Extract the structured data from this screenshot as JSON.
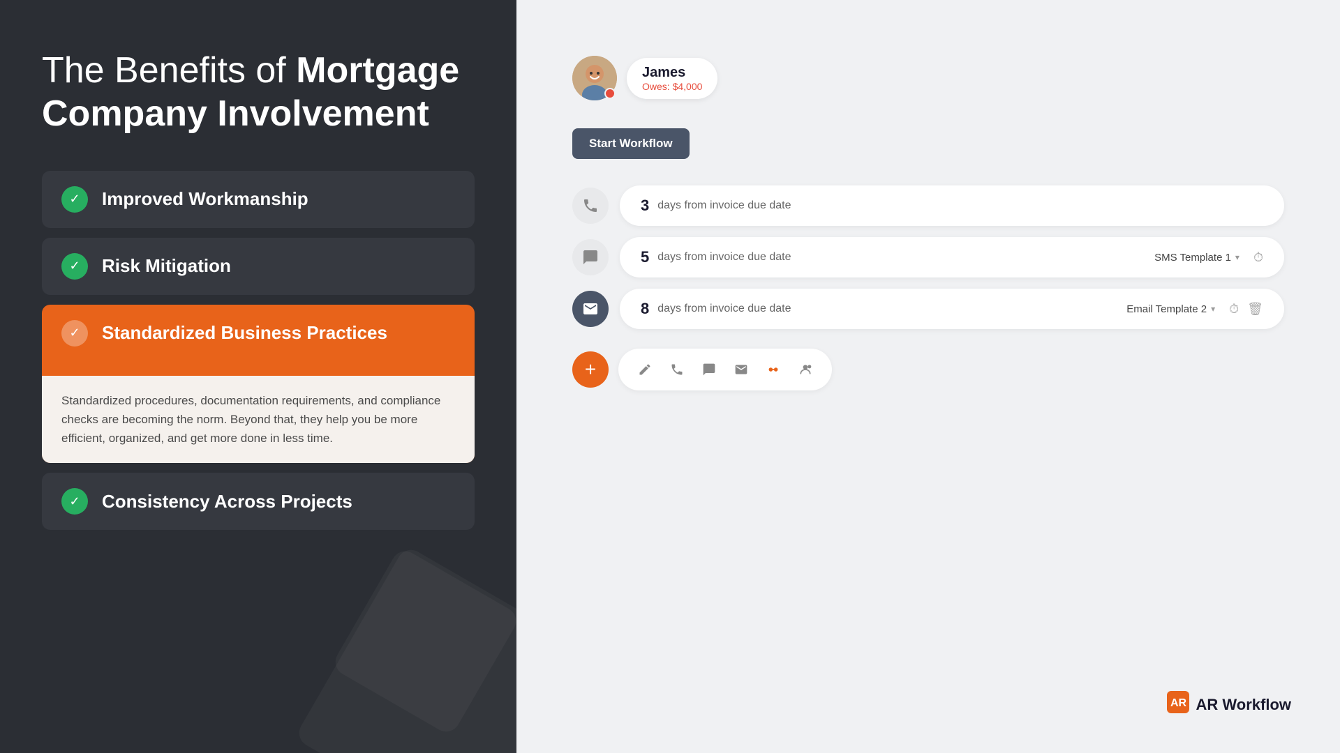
{
  "left": {
    "title_part1": "The Benefits of ",
    "title_part2": "Mortgage Company Involvement",
    "benefits": [
      {
        "id": "improved-workmanship",
        "label": "Improved Workmanship",
        "active": false,
        "expanded": false,
        "description": ""
      },
      {
        "id": "risk-mitigation",
        "label": "Risk Mitigation",
        "active": false,
        "expanded": false,
        "description": ""
      },
      {
        "id": "standardized-business-practices",
        "label": "Standardized Business Practices",
        "active": true,
        "expanded": true,
        "description": "Standardized procedures, documentation requirements, and compliance checks are becoming the norm. Beyond that, they help you be more efficient, organized, and get more done in less time."
      },
      {
        "id": "consistency-across-projects",
        "label": "Consistency Across Projects",
        "active": false,
        "expanded": false,
        "description": ""
      }
    ]
  },
  "right": {
    "user": {
      "name": "James",
      "owes_label": "Owes: $4,000"
    },
    "start_workflow_label": "Start Workflow",
    "steps": [
      {
        "id": "step-1",
        "icon_type": "phone",
        "days": "3",
        "days_text": "days from invoice due date",
        "template": "",
        "has_clock": false,
        "has_delete": false
      },
      {
        "id": "step-2",
        "icon_type": "chat",
        "days": "5",
        "days_text": "days from invoice due date",
        "template": "SMS Template 1",
        "has_clock": true,
        "has_delete": false
      },
      {
        "id": "step-3",
        "icon_type": "email",
        "days": "8",
        "days_text": "days from invoice due date",
        "template": "Email Template 2",
        "has_clock": true,
        "has_delete": true
      }
    ],
    "action_icons": [
      "edit",
      "phone",
      "chat",
      "email",
      "connect",
      "user-settings"
    ],
    "logo_text": "AR Workflow"
  }
}
